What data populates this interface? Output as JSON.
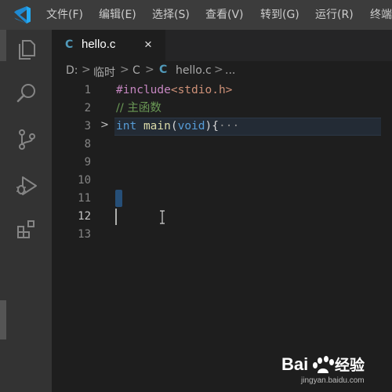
{
  "menu": {
    "items": [
      "文件(F)",
      "编辑(E)",
      "选择(S)",
      "查看(V)",
      "转到(G)",
      "运行(R)",
      "终端"
    ]
  },
  "activity_bar": {
    "icons": [
      "explorer-icon",
      "search-icon",
      "source-control-icon",
      "run-debug-icon",
      "extensions-icon"
    ]
  },
  "tab": {
    "icon_glyph": "C",
    "label": "hello.c",
    "close_glyph": "×"
  },
  "breadcrumb": {
    "parts": [
      "D:",
      "临时",
      "C",
      "hello.c",
      "..."
    ],
    "separator": ">",
    "file_icon_glyph": "C"
  },
  "editor": {
    "line_numbers": [
      "1",
      "2",
      "3",
      "8",
      "9",
      "10",
      "11",
      "12",
      "13"
    ],
    "active_line": "12",
    "lines": {
      "l1_directive": "#include",
      "l1_header": "<stdio.h>",
      "l2_comment": "// 主函数",
      "l3_type": "int",
      "l3_fn": "main",
      "l3_open": "(",
      "l3_param": "void",
      "l3_close": "){",
      "l3_folded": "···"
    },
    "fold_glyph": ">"
  },
  "watermark": {
    "brand": "Bai 经验",
    "url": "jingyan.baidu.com"
  },
  "colors": {
    "accent_blue": "#23a9f2",
    "c_file_icon": "#519aba",
    "keyword": "#569cd6",
    "function": "#dcdcaa",
    "string": "#ce9178",
    "preprocessor": "#c586c0",
    "comment": "#6a9955"
  }
}
